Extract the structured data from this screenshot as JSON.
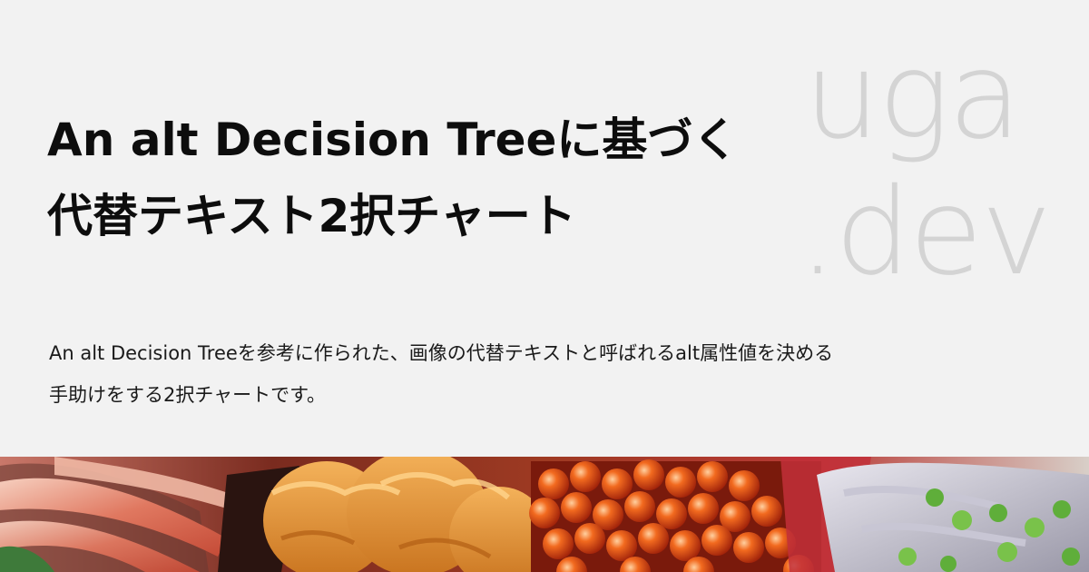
{
  "logo": {
    "line1": "uga",
    "line2": ".dev"
  },
  "title": {
    "line1": "An alt Decision Treeに基づく",
    "line2": "代替テキスト2択チャート"
  },
  "description": {
    "line1": "An alt Decision Treeを参考に作られた、画像の代替テキストと呼ばれるalt属性値を決める",
    "line2": "手助けをする2択チャートです。"
  },
  "colors": {
    "background": "#f2f2f2",
    "title": "#0d0d0d",
    "logo": "#d4d4d4"
  },
  "photo": {
    "subject": "sushi-platter-photo"
  }
}
